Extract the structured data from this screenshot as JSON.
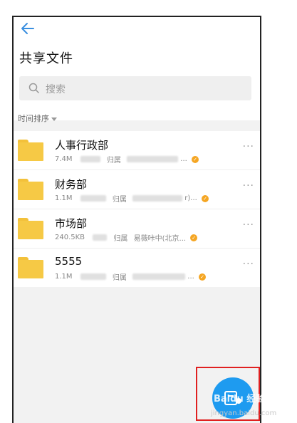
{
  "header": {
    "title": "共享文件"
  },
  "search": {
    "placeholder": "搜索"
  },
  "sort": {
    "label": "时间排序"
  },
  "files": [
    {
      "name": "人事行政部",
      "size": "7.4M",
      "owner_label": "归属",
      "owner_suffix": "..."
    },
    {
      "name": "财务部",
      "size": "1.1M",
      "owner_label": "归属",
      "owner_suffix": "r)..."
    },
    {
      "name": "市场部",
      "size": "240.5KB",
      "owner_label": "归属",
      "owner_suffix": "易薇咔中(北京..."
    },
    {
      "name": "5555",
      "size": "1.1M",
      "owner_label": "归属",
      "owner_suffix": "..."
    }
  ],
  "more_label": "···",
  "watermark": {
    "logo": "Baidu 经验",
    "url": "jingyan.baidu.com"
  },
  "colors": {
    "accent": "#1e9bf0",
    "folder": "#f6c945",
    "badge": "#f5a623",
    "highlight_frame": "#e02020"
  }
}
